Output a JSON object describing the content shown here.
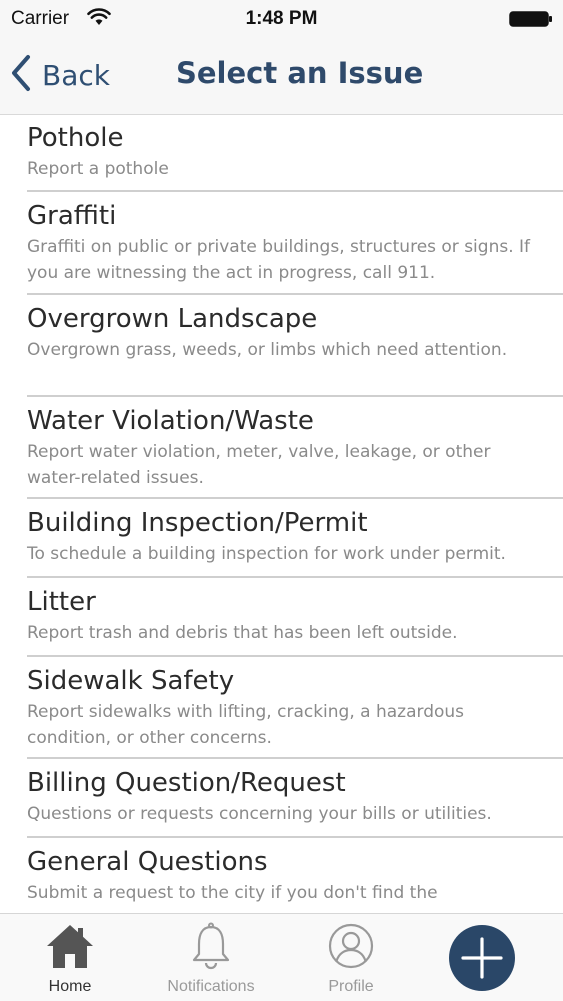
{
  "status_bar": {
    "carrier": "Carrier",
    "time": "1:48 PM"
  },
  "nav": {
    "back_label": "Back",
    "title": "Select an Issue"
  },
  "issues": [
    {
      "title": "Pothole",
      "description": "Report a pothole"
    },
    {
      "title": "Graffiti",
      "description": "Graffiti on public or private buildings, structures or signs. If you are witnessing the act in progress, call 911."
    },
    {
      "title": "Overgrown Landscape",
      "description": "Overgrown grass, weeds, or limbs which need attention."
    },
    {
      "title": "Water Violation/Waste",
      "description": "Report water violation, meter, valve, leakage, or other water-related issues."
    },
    {
      "title": "Building Inspection/Permit",
      "description": "To schedule a building inspection for work under permit."
    },
    {
      "title": "Litter",
      "description": "Report trash and debris that has been left outside."
    },
    {
      "title": "Sidewalk Safety",
      "description": "Report sidewalks with lifting, cracking, a hazardous condition, or other concerns."
    },
    {
      "title": "Billing Question/Request",
      "description": "Questions or requests concerning your bills or utilities."
    },
    {
      "title": "General Questions",
      "description": "Submit a request to the city if you don't find the"
    }
  ],
  "tab_bar": {
    "home_label": "Home",
    "notifications_label": "Notifications",
    "profile_label": "Profile"
  },
  "colors": {
    "accent": "#2f4a6b",
    "add_button": "#2a4768"
  },
  "icons": {
    "back": "chevron-left-icon",
    "home": "home-icon",
    "notifications": "bell-icon",
    "profile": "user-icon",
    "add": "plus-icon"
  }
}
